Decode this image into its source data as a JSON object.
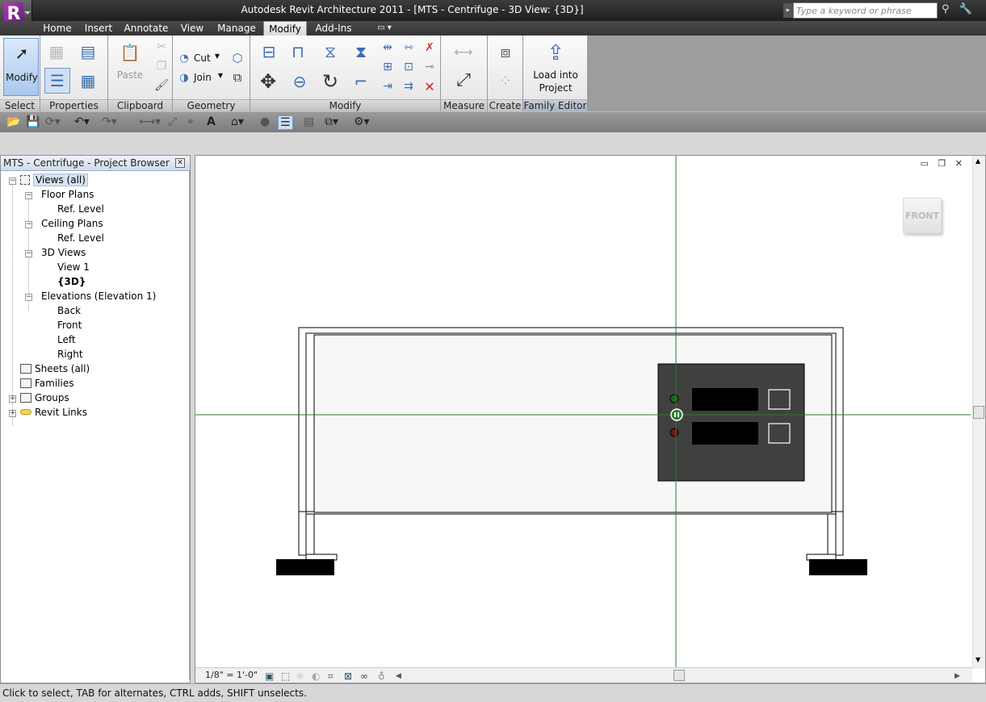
{
  "window": {
    "title": "Autodesk Revit Architecture 2011 - [MTS - Centrifuge - 3D View: {3D}]"
  },
  "search": {
    "placeholder": "Type a keyword or phrase"
  },
  "tabs": [
    {
      "label": "Home"
    },
    {
      "label": "Insert"
    },
    {
      "label": "Annotate"
    },
    {
      "label": "View"
    },
    {
      "label": "Manage"
    },
    {
      "label": "Modify"
    },
    {
      "label": "Add-Ins"
    }
  ],
  "ribbon": {
    "modify_button": "Modify",
    "paste": "Paste",
    "cut": "Cut",
    "join": "Join",
    "load_into_project_line1": "Load into",
    "load_into_project_line2": "Project",
    "panels": {
      "select": "Select",
      "properties": "Properties",
      "clipboard": "Clipboard",
      "geometry": "Geometry",
      "modify": "Modify",
      "measure": "Measure",
      "create": "Create",
      "family_editor": "Family Editor"
    }
  },
  "browser": {
    "title": "MTS - Centrifuge - Project Browser",
    "tree": {
      "views_all": "Views (all)",
      "floor_plans": "Floor Plans",
      "floor_ref": "Ref. Level",
      "ceiling_plans": "Ceiling Plans",
      "ceiling_ref": "Ref. Level",
      "views_3d": "3D Views",
      "view_1": "View 1",
      "view_3d": "{3D}",
      "elevations": "Elevations (Elevation 1)",
      "back": "Back",
      "front": "Front",
      "left": "Left",
      "right": "Right",
      "sheets": "Sheets (all)",
      "families": "Families",
      "groups": "Groups",
      "revit_links": "Revit Links"
    }
  },
  "viewcube": {
    "face": "FRONT"
  },
  "view_control": {
    "scale": "1/8\" = 1'-0\""
  },
  "status": {
    "text": "Click to select, TAB for alternates, CTRL adds, SHIFT unselects."
  },
  "colors": {
    "accent": "#3a6fb0",
    "ref_line": "#2e7d32",
    "panel": "#404040"
  }
}
